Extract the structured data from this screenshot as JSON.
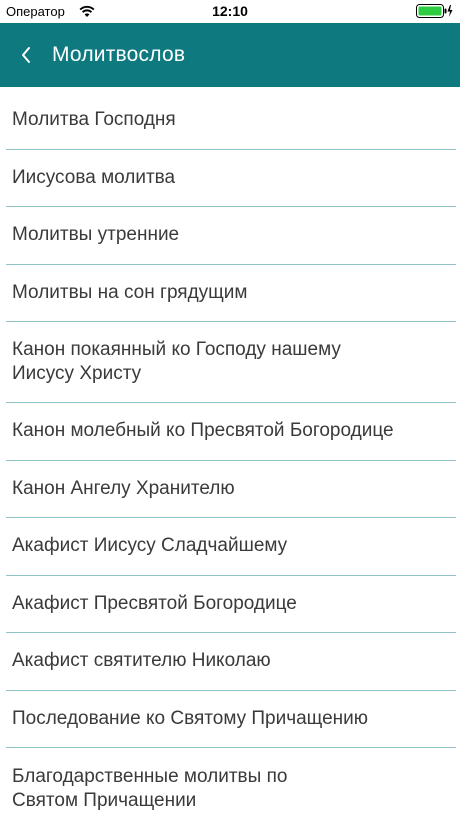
{
  "status_bar": {
    "carrier": "Оператор",
    "time": "12:10",
    "wifi_icon": "wifi-icon",
    "battery_icon": "battery-charging-icon"
  },
  "nav": {
    "title": "Молитвослов",
    "back_icon": "chevron-left-icon",
    "background_color": "#0e7a80"
  },
  "items": [
    {
      "label": "Молитва Господня"
    },
    {
      "label": "Иисусова молитва"
    },
    {
      "label": "Молитвы утренние"
    },
    {
      "label": "Молитвы на сон грядущим"
    },
    {
      "label": "Канон покаянный ко Господу нашему Иисусу Христу"
    },
    {
      "label": "Канон молебный ко Пресвятой Богородице"
    },
    {
      "label": "Канон Ангелу Хранителю"
    },
    {
      "label": "Акафист Иисусу Сладчайшему"
    },
    {
      "label": "Акафист Пресвятой Богородице"
    },
    {
      "label": "Акафист святителю Николаю"
    },
    {
      "label": "Последование ко Святому Причащению"
    },
    {
      "label": "Благодарственные молитвы по Святом Причащении"
    }
  ],
  "divider_color": "#8fc3c6"
}
